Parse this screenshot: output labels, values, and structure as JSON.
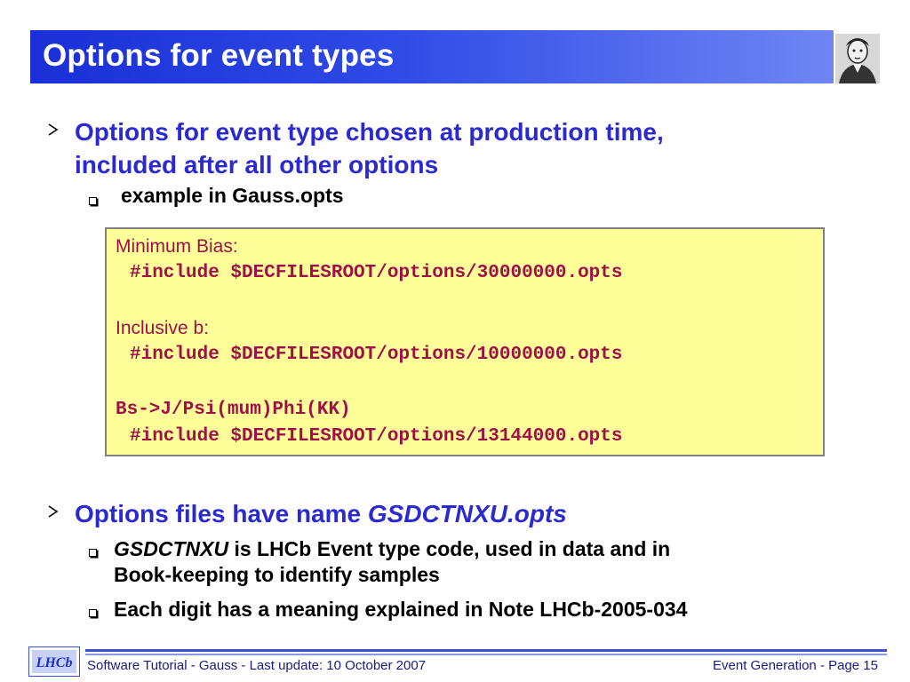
{
  "slide": {
    "title": "Options for event types"
  },
  "bullet1": {
    "line1": "Options for event type chosen at production time,",
    "line2": "included after all other options",
    "sub": "example in Gauss.opts"
  },
  "codebox": {
    "label1": "Minimum Bias:",
    "code1": "#include $DECFILESROOT/options/30000000.opts",
    "label2": "Inclusive b:",
    "code2": "#include $DECFILESROOT/options/10000000.opts",
    "label3": "Bs->J/Psi(mum)Phi(KK)",
    "code3": "#include $DECFILESROOT/options/13144000.opts"
  },
  "bullet2": {
    "prefix": "Options files have name ",
    "name": "GSDCTNXU.opts",
    "sub1_term": "GSDCTNXU",
    "sub1_rest": " is LHCb Event type code, used in data and in",
    "sub1_line2": "Book-keeping to identify samples",
    "sub2": "Each digit has a meaning explained in Note LHCb-2005-034"
  },
  "footer": {
    "logo_text": "LHCb",
    "left": "Software Tutorial - Gauss - Last update: 10 October 2007",
    "right": "Event Generation - Page 15"
  },
  "colors": {
    "title_bar": "#1a2fd6",
    "bullet_text": "#2a2ad0",
    "code_text": "#a01048",
    "code_bg": "#ffff99"
  },
  "icons": [
    "arrow-bullet-icon",
    "square-bullet-icon",
    "portrait-icon",
    "lhcb-logo-icon"
  ]
}
